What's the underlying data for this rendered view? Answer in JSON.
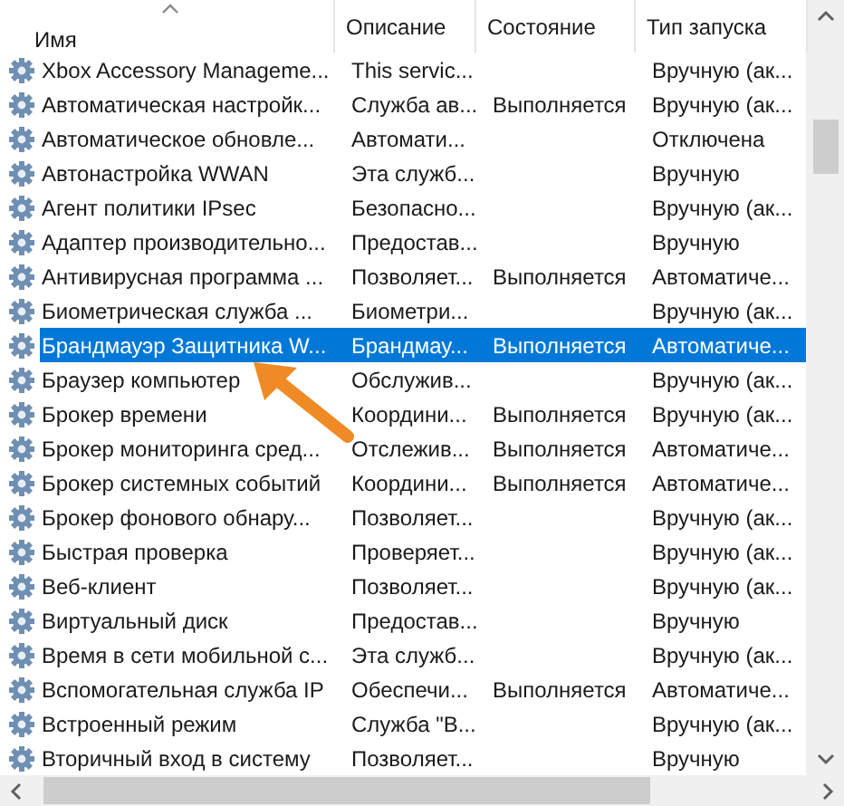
{
  "columns": [
    {
      "label": "Имя",
      "sorted": true
    },
    {
      "label": "Описание",
      "sorted": false
    },
    {
      "label": "Состояние",
      "sorted": false
    },
    {
      "label": "Тип запуска",
      "sorted": false
    }
  ],
  "rows": [
    {
      "name": "Xbox Accessory Manageme...",
      "description": "This servic...",
      "status": "",
      "startup": "Вручную (ак...",
      "selected": false
    },
    {
      "name": "Автоматическая настройк...",
      "description": "Служба ав...",
      "status": "Выполняется",
      "startup": "Вручную (ак...",
      "selected": false
    },
    {
      "name": "Автоматическое обновле...",
      "description": "Автомати...",
      "status": "",
      "startup": "Отключена",
      "selected": false
    },
    {
      "name": "Автонастройка WWAN",
      "description": "Эта служб...",
      "status": "",
      "startup": "Вручную",
      "selected": false
    },
    {
      "name": "Агент политики IPsec",
      "description": "Безопасно...",
      "status": "",
      "startup": "Вручную (ак...",
      "selected": false
    },
    {
      "name": "Адаптер производительно...",
      "description": "Предостав...",
      "status": "",
      "startup": "Вручную",
      "selected": false
    },
    {
      "name": "Антивирусная программа ...",
      "description": "Позволяет...",
      "status": "Выполняется",
      "startup": "Автоматиче...",
      "selected": false
    },
    {
      "name": "Биометрическая служба ...",
      "description": "Биометри...",
      "status": "",
      "startup": "Вручную (ак...",
      "selected": false
    },
    {
      "name": "Брандмауэр Защитника W...",
      "description": "Брандмау...",
      "status": "Выполняется",
      "startup": "Автоматиче...",
      "selected": true
    },
    {
      "name": "Браузер компьютер",
      "description": "Обслужив...",
      "status": "",
      "startup": "Вручную (ак...",
      "selected": false
    },
    {
      "name": "Брокер времени",
      "description": "Координи...",
      "status": "Выполняется",
      "startup": "Вручную (ак...",
      "selected": false
    },
    {
      "name": "Брокер мониторинга сред...",
      "description": "Отслежив...",
      "status": "Выполняется",
      "startup": "Автоматиче...",
      "selected": false
    },
    {
      "name": "Брокер системных событий",
      "description": "Координи...",
      "status": "Выполняется",
      "startup": "Автоматиче...",
      "selected": false
    },
    {
      "name": "Брокер фонового обнару...",
      "description": "Позволяет...",
      "status": "",
      "startup": "Вручную (ак...",
      "selected": false
    },
    {
      "name": "Быстрая проверка",
      "description": "Проверяет...",
      "status": "",
      "startup": "Вручную (ак...",
      "selected": false
    },
    {
      "name": "Веб-клиент",
      "description": "Позволяет...",
      "status": "",
      "startup": "Вручную (ак...",
      "selected": false
    },
    {
      "name": "Виртуальный диск",
      "description": "Предостав...",
      "status": "",
      "startup": "Вручную",
      "selected": false
    },
    {
      "name": "Время в сети мобильной с...",
      "description": "Эта служб...",
      "status": "",
      "startup": "Вручную (ак...",
      "selected": false
    },
    {
      "name": "Вспомогательная служба IP",
      "description": "Обеспечи...",
      "status": "Выполняется",
      "startup": "Автоматиче...",
      "selected": false
    },
    {
      "name": "Встроенный режим",
      "description": "Служба \"В...",
      "status": "",
      "startup": "Вручную (ак...",
      "selected": false
    },
    {
      "name": "Вторичный вход в систему",
      "description": "Позволяет...",
      "status": "",
      "startup": "Вручную",
      "selected": false
    }
  ]
}
